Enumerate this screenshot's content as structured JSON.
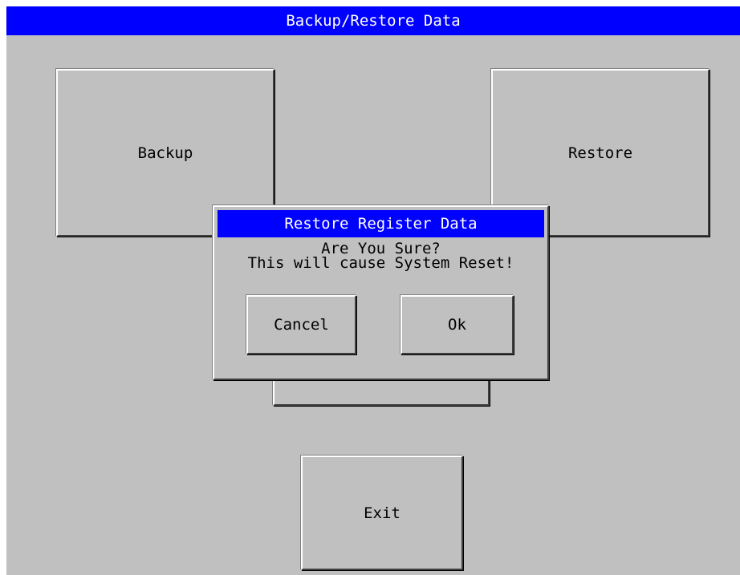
{
  "window": {
    "title": "Backup/Restore Data"
  },
  "buttons": {
    "backup_label": "Backup",
    "restore_label": "Restore",
    "exit_label": "Exit"
  },
  "dialog": {
    "title": "Restore Register Data",
    "message_line1": "Are You Sure?",
    "message_line2": "This will cause System Reset!",
    "cancel_label": "Cancel",
    "ok_label": "Ok"
  },
  "colors": {
    "titlebar": "#0000ff",
    "background": "#c0c0c0",
    "title_text": "#ffffff"
  }
}
